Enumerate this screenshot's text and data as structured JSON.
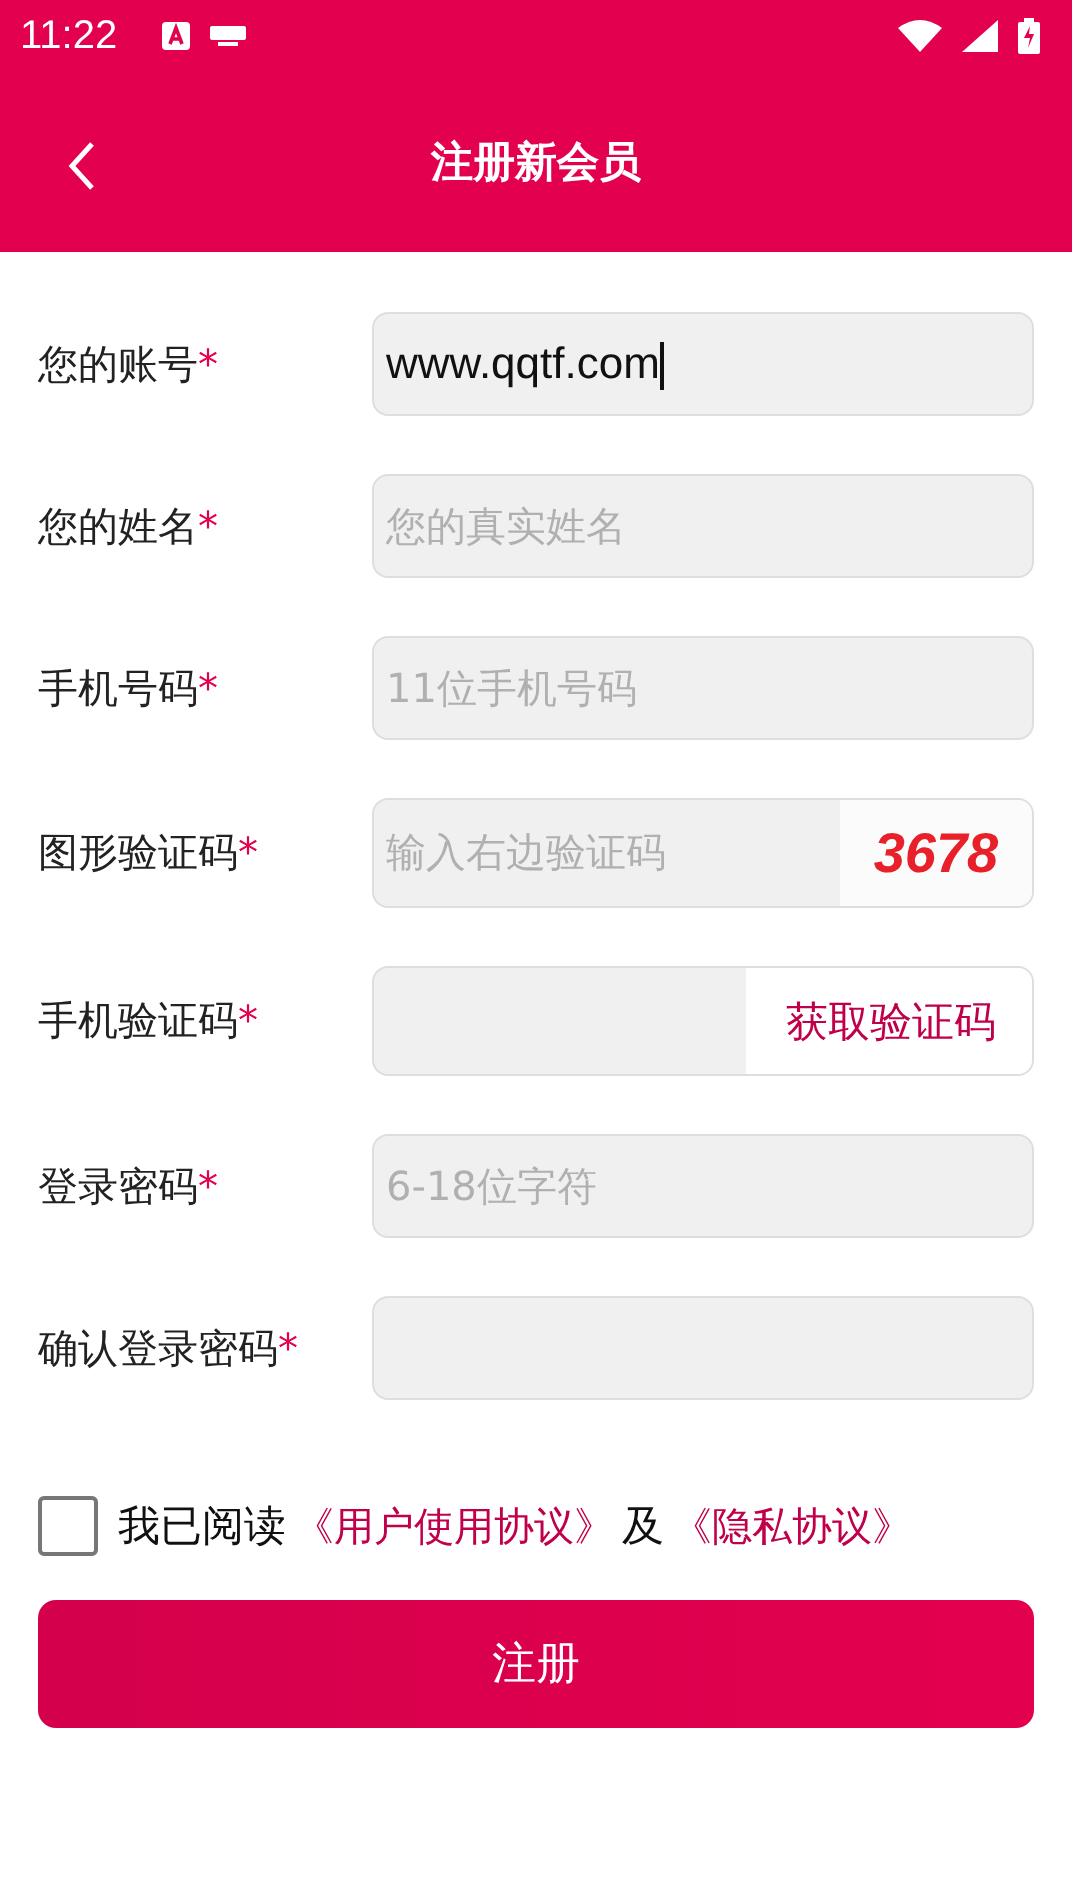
{
  "status_bar": {
    "time": "11:22"
  },
  "header": {
    "title": "注册新会员"
  },
  "fields": [
    {
      "label": "您的账号",
      "required_mark": "*",
      "value": "www.qqtf.com",
      "focused": true
    },
    {
      "label": "您的姓名",
      "required_mark": "*",
      "placeholder": "您的真实姓名",
      "focused": false
    },
    {
      "label": "手机号码",
      "required_mark": "*",
      "placeholder": "11位手机号码",
      "focused": false
    },
    {
      "label": "图形验证码",
      "required_mark": "*",
      "placeholder": "输入右边验证码",
      "focused": false,
      "addon": {
        "kind": "captcha",
        "text": "3678"
      }
    },
    {
      "label": "手机验证码",
      "required_mark": "*",
      "focused": false,
      "addon": {
        "kind": "button",
        "text": "获取验证码"
      }
    },
    {
      "label": "登录密码",
      "required_mark": "*",
      "placeholder": "6-18位字符",
      "focused": false
    },
    {
      "label": "确认登录密码",
      "required_mark": "*",
      "focused": false
    }
  ],
  "agreement": {
    "checked": false,
    "prefix": "我已阅读",
    "link_1": "《用户使用协议》",
    "joiner": "及",
    "link_2": "《隐私协议》"
  },
  "submit": {
    "label": "注册"
  }
}
